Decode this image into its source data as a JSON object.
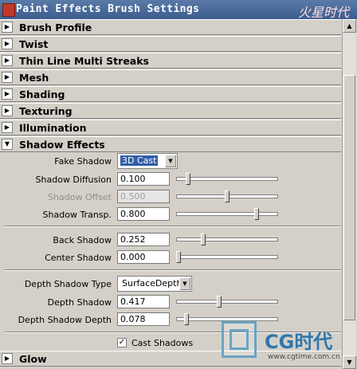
{
  "window": {
    "title": "Paint Effects Brush Settings",
    "logo_text": "火星时代"
  },
  "sections_top": [
    {
      "label": "Brush Profile"
    },
    {
      "label": "Twist"
    },
    {
      "label": "Thin Line Multi Streaks"
    },
    {
      "label": "Mesh"
    },
    {
      "label": "Shading"
    },
    {
      "label": "Texturing"
    },
    {
      "label": "Illumination"
    }
  ],
  "shadow_effects": {
    "label": "Shadow Effects",
    "fake_shadow": {
      "label": "Fake Shadow",
      "value": "3D Cast"
    },
    "shadow_diffusion": {
      "label": "Shadow Diffusion",
      "value": "0.100",
      "slider": 0.1
    },
    "shadow_offset": {
      "label": "Shadow Offset",
      "value": "0.500",
      "slider": 0.5
    },
    "shadow_transp": {
      "label": "Shadow Transp.",
      "value": "0.800",
      "slider": 0.8
    },
    "back_shadow": {
      "label": "Back Shadow",
      "value": "0.252",
      "slider": 0.252
    },
    "center_shadow": {
      "label": "Center Shadow",
      "value": "0.000",
      "slider": 0.0
    },
    "depth_shadow_type": {
      "label": "Depth Shadow Type",
      "value": "SurfaceDepth"
    },
    "depth_shadow": {
      "label": "Depth Shadow",
      "value": "0.417",
      "slider": 0.417
    },
    "depth_shadow_depth": {
      "label": "Depth Shadow Depth",
      "value": "0.078",
      "slider": 0.078
    },
    "cast_shadows": {
      "label": "Cast Shadows",
      "checked": true
    }
  },
  "glow": {
    "label": "Glow"
  },
  "watermark": {
    "brand": "CG时代",
    "url": "www.cgtime.com.cn"
  }
}
